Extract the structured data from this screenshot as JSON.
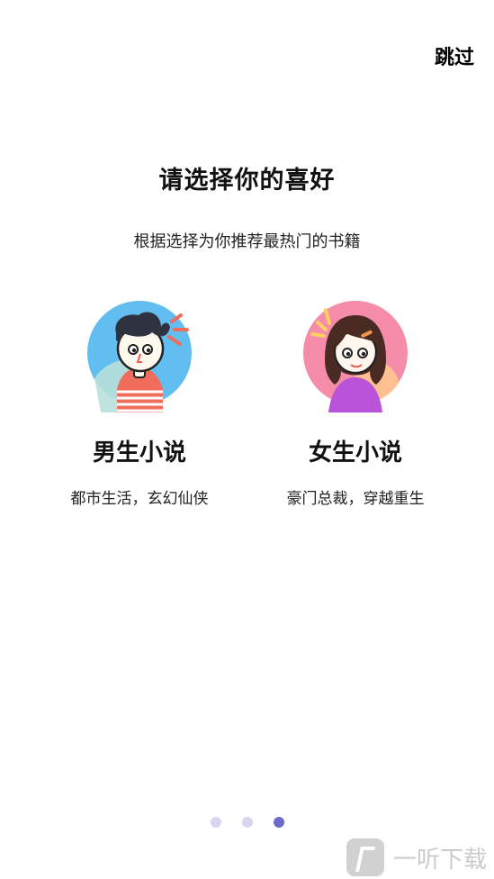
{
  "header": {
    "skip_label": "跳过"
  },
  "intro": {
    "title": "请选择你的喜好",
    "subtitle": "根据选择为你推荐最热门的书籍"
  },
  "choices": [
    {
      "title": "男生小说",
      "description": "都市生活，玄幻仙侠",
      "icon": "male-avatar-icon"
    },
    {
      "title": "女生小说",
      "description": "豪门总裁，穿越重生",
      "icon": "female-avatar-icon"
    }
  ],
  "pagination": {
    "current_page": 3,
    "total_pages": 3
  },
  "watermark": {
    "text": "一听下载"
  },
  "colors": {
    "accent": "#6f6ac9",
    "inactive_dot": "#d8d5f0"
  }
}
